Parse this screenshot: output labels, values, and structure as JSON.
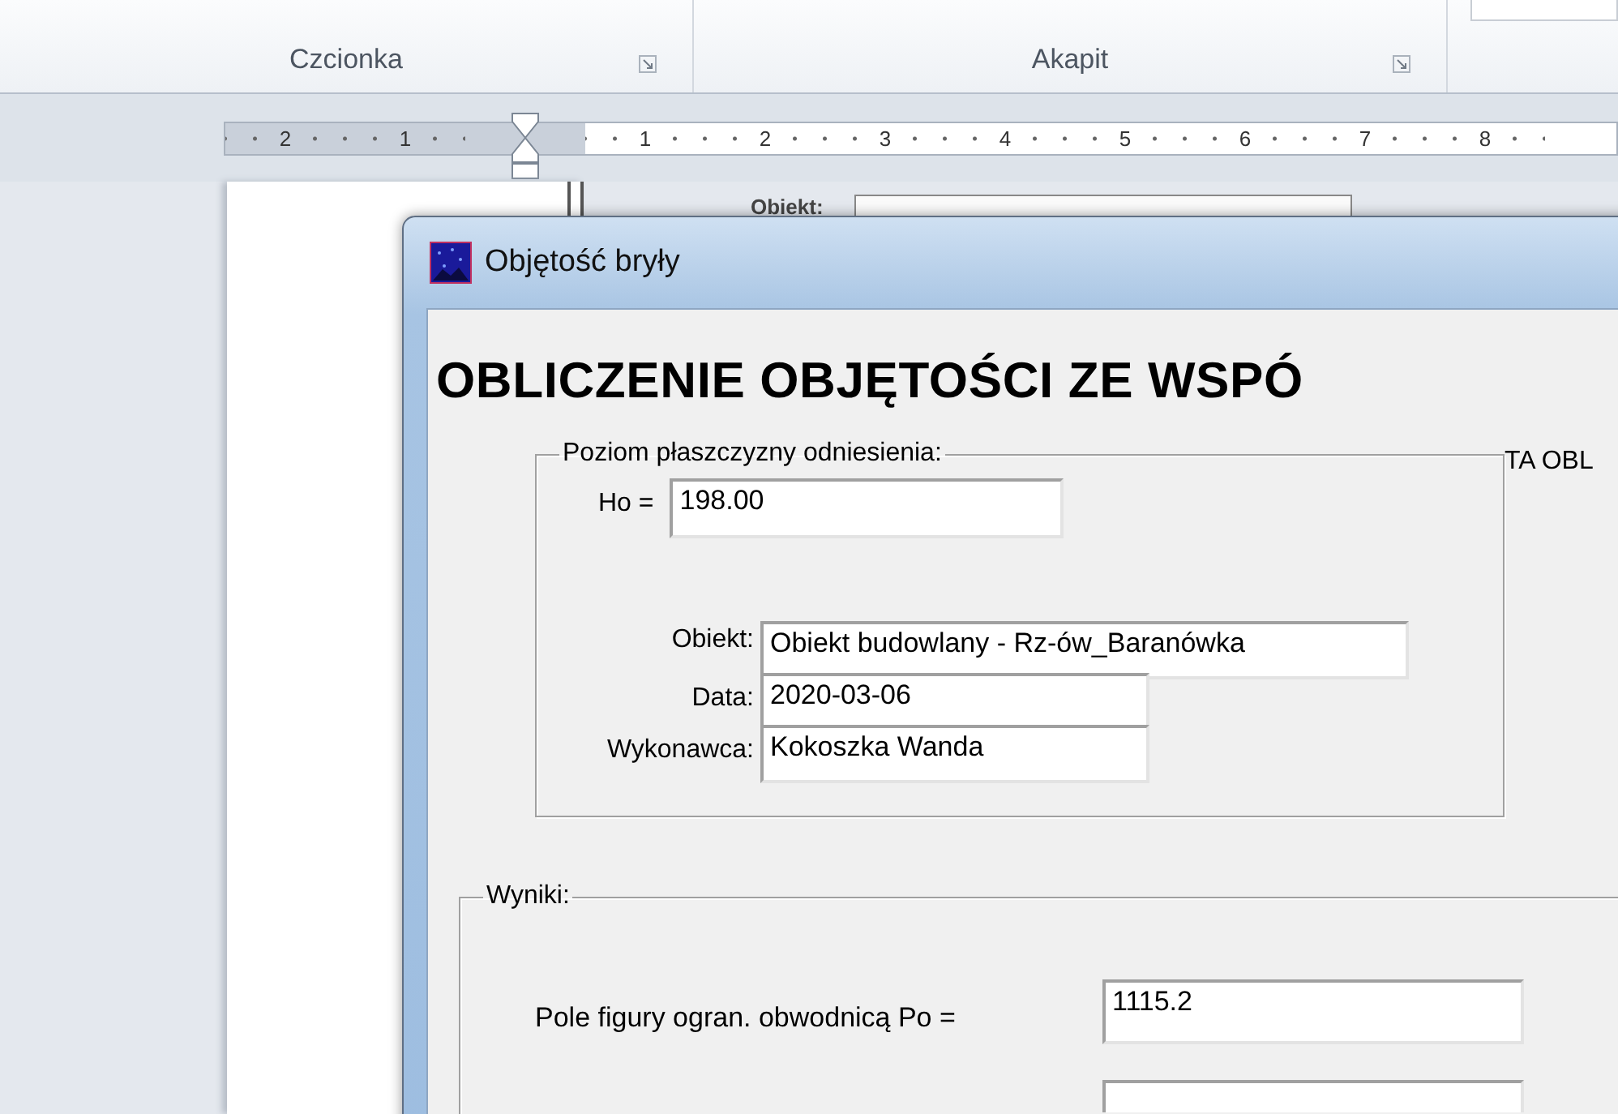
{
  "ribbon": {
    "groups": [
      {
        "label": "Czcionka"
      },
      {
        "label": "Akapit"
      }
    ]
  },
  "ruler": {
    "left_labels": [
      "2",
      "1"
    ],
    "right_labels": [
      "1",
      "2",
      "3",
      "4",
      "5",
      "6",
      "7",
      "8"
    ]
  },
  "background_doc": {
    "label": "Obiekt:"
  },
  "dialog": {
    "title": "Objętość bryły",
    "heading": "OBLICZENIE OBJĘTOŚCI ZE WSPÓ",
    "reference_group": {
      "legend": "Poziom płaszczyzny odniesienia:",
      "level_label": "Ho =",
      "level_value": "198.00",
      "fields": [
        {
          "label": "Obiekt:",
          "value": "Obiekt budowlany - Rz-ów_Baranówka"
        },
        {
          "label": "Data:",
          "value": "2020-03-06"
        },
        {
          "label": "Wykonawca:",
          "value": "Kokoszka Wanda"
        }
      ]
    },
    "side_text": "TA OBL",
    "results_group": {
      "legend": "Wyniki:",
      "fields": [
        {
          "label": "Pole figury ogran. obwodnicą  Po =",
          "value": "1115.2"
        }
      ]
    }
  }
}
